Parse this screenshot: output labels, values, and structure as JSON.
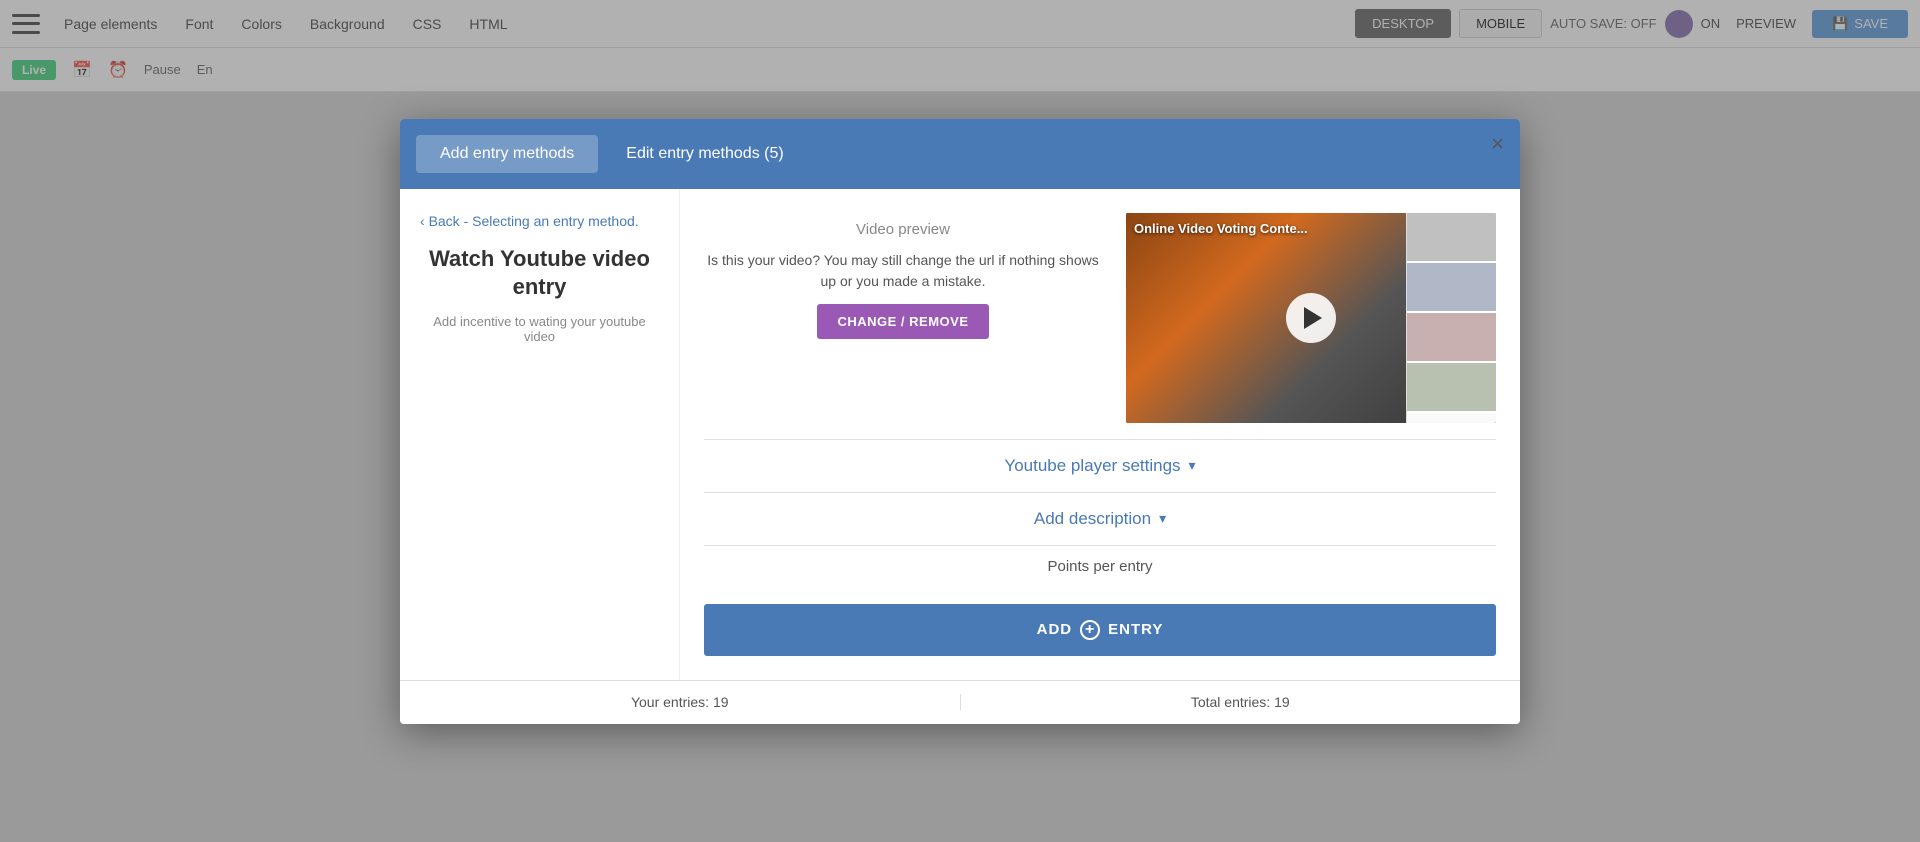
{
  "toolbar": {
    "hamburger_label": "Menu",
    "nav_items": [
      "Page elements",
      "Font",
      "Colors",
      "Background",
      "CSS",
      "HTML"
    ],
    "desktop_label": "DESKTOP",
    "mobile_label": "MOBILE",
    "autosave_label": "AUTO SAVE: OFF",
    "on_label": "ON",
    "preview_label": "PREVIEW",
    "save_label": "SAVE",
    "save_icon": "save-icon"
  },
  "toolbar2": {
    "live_label": "Live",
    "calendar_icon": "calendar-icon",
    "clock_icon": "clock-icon",
    "pause_label": "Pause",
    "entries_label": "En"
  },
  "modal": {
    "close_label": "×",
    "tabs": [
      {
        "id": "add",
        "label": "Add entry methods",
        "active": true
      },
      {
        "id": "edit",
        "label": "Edit entry methods (5)",
        "active": false
      }
    ],
    "back_link": "Back - Selecting an entry method.",
    "entry_title": "Watch Youtube video entry",
    "entry_desc": "Add incentive to wating your youtube video",
    "video_preview": {
      "title": "Video preview",
      "description": "Is this your video? You may still change the url if nothing shows up or you made a mistake.",
      "change_remove_btn": "CHANGE / REMOVE",
      "video_title": "Online Video Voting Conte..."
    },
    "youtube_settings": {
      "label": "Youtube player settings",
      "chevron": "▾"
    },
    "add_description": {
      "label": "Add description",
      "chevron": "▾"
    },
    "points_section": {
      "label": "Points per entry"
    },
    "add_entry_btn": "ADD",
    "add_entry_suffix": "ENTRY"
  },
  "footer": {
    "your_entries_label": "Your entries: 19",
    "total_entries_label": "Total entries: 19"
  },
  "colors": {
    "modal_tab_bg": "#4a7ab5",
    "active_tab_bg": "rgba(255,255,255,0.25)",
    "change_btn_bg": "#9b59b6",
    "add_entry_btn_bg": "#4a7ab5",
    "back_link_color": "#4a7ab5",
    "collapsible_color": "#4a7ab5"
  }
}
